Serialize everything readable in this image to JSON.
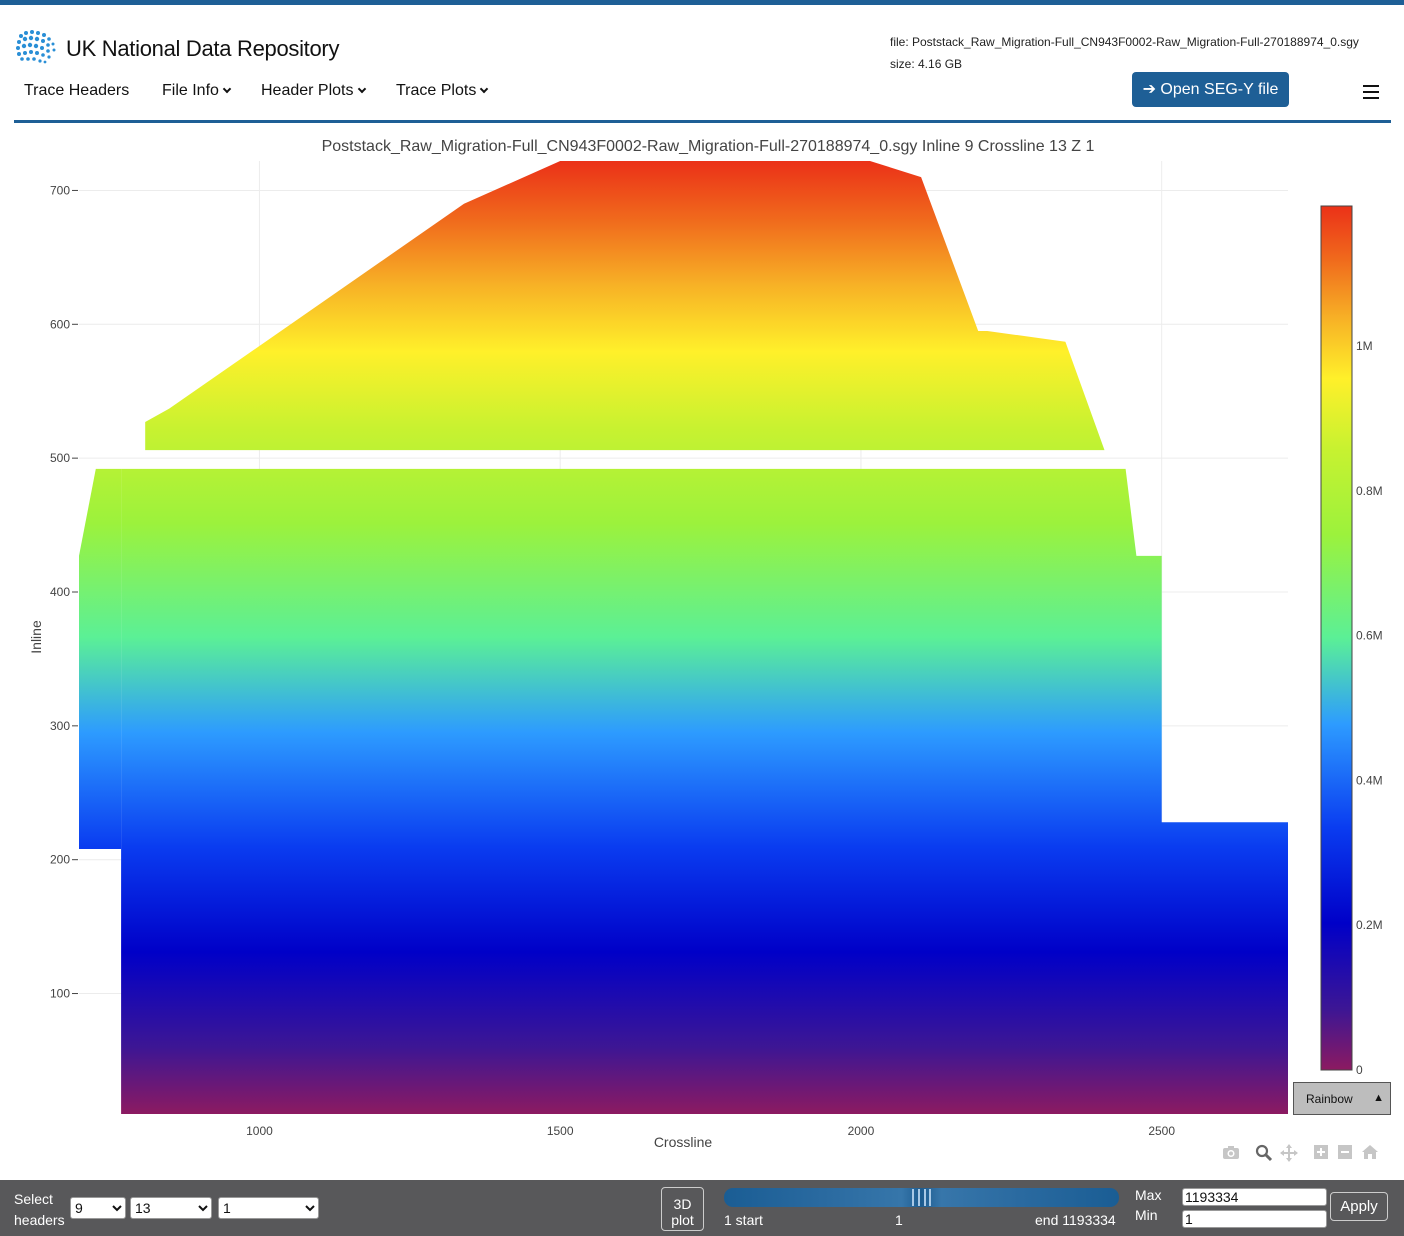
{
  "header": {
    "brand": "UK National Data Repository",
    "file_line": "file: Poststack_Raw_Migration-Full_CN943F0002-Raw_Migration-Full-270188974_0.sgy",
    "size_line": "size: 4.16 GB",
    "open_button": "➔ Open SEG-Y file"
  },
  "nav": {
    "items": [
      {
        "label": "Trace Headers",
        "dropdown": false
      },
      {
        "label": "File Info",
        "dropdown": true
      },
      {
        "label": "Header Plots",
        "dropdown": true
      },
      {
        "label": "Trace Plots",
        "dropdown": true
      }
    ]
  },
  "chart_data": {
    "type": "heatmap",
    "title": "Poststack_Raw_Migration-Full_CN943F0002-Raw_Migration-Full-270188974_0.sgy Inline 9 Crossline 13 Z 1",
    "xlabel": "Crossline",
    "ylabel": "Inline",
    "xlim": [
      700,
      2710
    ],
    "ylim": [
      10,
      722
    ],
    "x_ticks": [
      1000,
      1500,
      2000,
      2500
    ],
    "y_ticks": [
      100,
      200,
      300,
      400,
      500,
      600,
      700
    ],
    "grid": true,
    "colorscale": "Rainbow",
    "color_range": [
      0,
      1193334
    ],
    "colorbar_ticks": [
      {
        "value": 0,
        "label": "0"
      },
      {
        "value": 200000,
        "label": "0.2M"
      },
      {
        "value": 400000,
        "label": "0.4M"
      },
      {
        "value": 600000,
        "label": "0.6M"
      },
      {
        "value": 800000,
        "label": "0.8M"
      },
      {
        "value": 1000000,
        "label": "1M"
      }
    ],
    "value_field": "trace index increasing with Inline",
    "coverage_outline": {
      "lower_block": [
        [
          770,
          10
        ],
        [
          2710,
          10
        ],
        [
          2710,
          228
        ],
        [
          2500,
          228
        ],
        [
          2500,
          427
        ],
        [
          2458,
          427
        ],
        [
          2440,
          492
        ],
        [
          770,
          492
        ]
      ],
      "lower_left_strip": [
        [
          700,
          208
        ],
        [
          770,
          208
        ],
        [
          770,
          492
        ],
        [
          728,
          492
        ],
        [
          700,
          427
        ]
      ],
      "upper_block": [
        [
          775,
          506
        ],
        [
          2405,
          506
        ],
        [
          2340,
          587
        ],
        [
          2210,
          595
        ],
        [
          2195,
          595
        ],
        [
          2100,
          710
        ],
        [
          2015,
          722
        ],
        [
          1500,
          722
        ],
        [
          1340,
          690
        ],
        [
          850,
          537
        ],
        [
          810,
          527
        ],
        [
          810,
          506
        ]
      ]
    },
    "colorscale_button": "Rainbow",
    "colorscale_arrow": "▲"
  },
  "controls": {
    "select_label": "Select headers",
    "inline_select": "9",
    "crossline_select": "13",
    "z_select": "1",
    "btn_3d": "3D plot",
    "slider": {
      "start_label": "1 start",
      "value_label": "1",
      "end_label": "end 1193334",
      "value": 0.5
    },
    "max_label": "Max",
    "min_label": "Min",
    "max_value": "1193334",
    "min_value": "1",
    "apply": "Apply"
  },
  "colors": {
    "brand": "#1e5f96",
    "footer": "#58585a",
    "icon_name_logo": "globe-logo-icon"
  }
}
